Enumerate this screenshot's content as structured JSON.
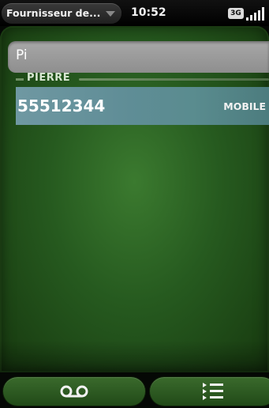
{
  "status_bar": {
    "carrier": "Fournisseur de...",
    "time": "10:52",
    "network": "3G"
  },
  "search": {
    "value": "Pi"
  },
  "results": {
    "group_name": "PIERRE",
    "entries": [
      {
        "number": "55512344",
        "type": "MOBILE"
      }
    ]
  },
  "command_menu": {
    "buttons": [
      {
        "icon": "voicemail-icon"
      },
      {
        "icon": "list-icon"
      }
    ]
  },
  "colors": {
    "panel_green": "#265a1f",
    "highlight_row": "#5f8d96"
  }
}
